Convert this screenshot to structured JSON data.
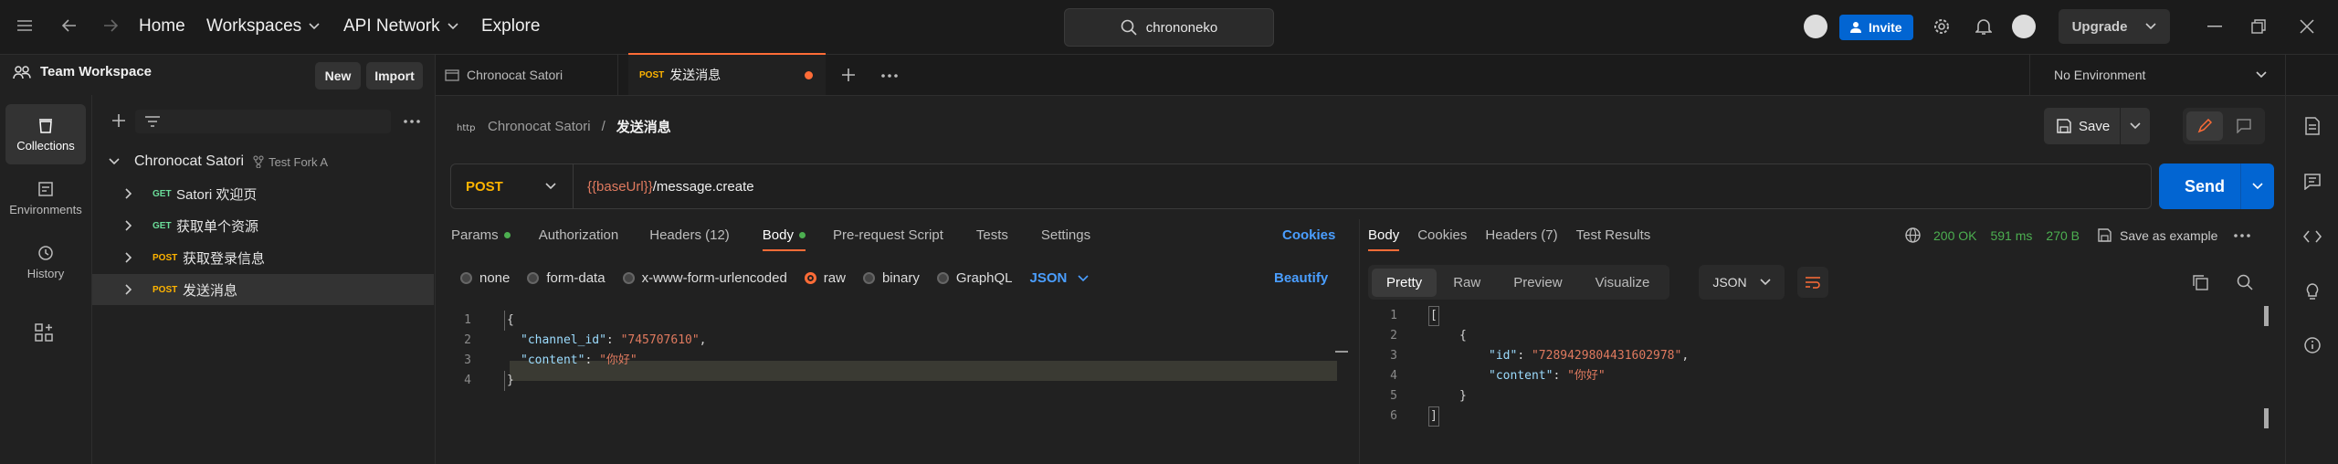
{
  "topbar": {
    "nav": [
      "Home",
      "Workspaces",
      "API Network",
      "Explore"
    ],
    "search_value": "chrononeko",
    "invite_label": "Invite",
    "upgrade_label": "Upgrade"
  },
  "workspace": {
    "name": "Team Workspace",
    "new_label": "New",
    "import_label": "Import"
  },
  "rail": {
    "items": [
      "Collections",
      "Environments",
      "History"
    ]
  },
  "collection": {
    "name": "Chronocat Satori",
    "fork_label": "Test Fork A",
    "requests": [
      {
        "method": "GET",
        "name": "Satori 欢迎页"
      },
      {
        "method": "GET",
        "name": "获取单个资源"
      },
      {
        "method": "POST",
        "name": "获取登录信息"
      },
      {
        "method": "POST",
        "name": "发送消息"
      }
    ]
  },
  "tabs": {
    "tab1": "Chronocat Satori",
    "tab2_method": "POST",
    "tab2_name": "发送消息",
    "environment": "No Environment"
  },
  "request": {
    "breadcrumb_parent": "Chronocat Satori",
    "breadcrumb_sep": "/",
    "breadcrumb_current": "发送消息",
    "save_label": "Save",
    "method": "POST",
    "url_var": "{{baseUrl}}",
    "url_path": "/message.create",
    "send_label": "Send",
    "subtabs": [
      "Params",
      "Authorization",
      "Headers (12)",
      "Body",
      "Pre-request Script",
      "Tests",
      "Settings"
    ],
    "cookies_label": "Cookies",
    "body_modes": [
      "none",
      "form-data",
      "x-www-form-urlencoded",
      "raw",
      "binary",
      "GraphQL"
    ],
    "body_format": "JSON",
    "beautify_label": "Beautify",
    "line_numbers": [
      "1",
      "2",
      "3",
      "4"
    ],
    "code": {
      "open": "{",
      "k1": "\"channel_id\"",
      "v1": "\"745707610\"",
      "k2": "\"content\"",
      "v2": "\"你好\"",
      "close": "}"
    }
  },
  "response": {
    "tabs": [
      "Body",
      "Cookies",
      "Headers (7)",
      "Test Results"
    ],
    "status": "200 OK",
    "time": "591 ms",
    "size": "270 B",
    "save_example_label": "Save as example",
    "views": [
      "Pretty",
      "Raw",
      "Preview",
      "Visualize"
    ],
    "format": "JSON",
    "line_numbers": [
      "1",
      "2",
      "3",
      "4",
      "5",
      "6"
    ],
    "code": {
      "open_arr": "[",
      "open_obj": "{",
      "k1": "\"id\"",
      "v1": "\"7289429804431602978\"",
      "k2": "\"content\"",
      "v2": "\"你好\"",
      "close_obj": "}",
      "close_arr": "]"
    }
  },
  "colors": {
    "accent": "#ff6c37",
    "send": "#0265d2",
    "invite": "#0265d2",
    "status_ok": "#4caf50",
    "get": "#6bdd9a",
    "post": "#ffb400"
  }
}
